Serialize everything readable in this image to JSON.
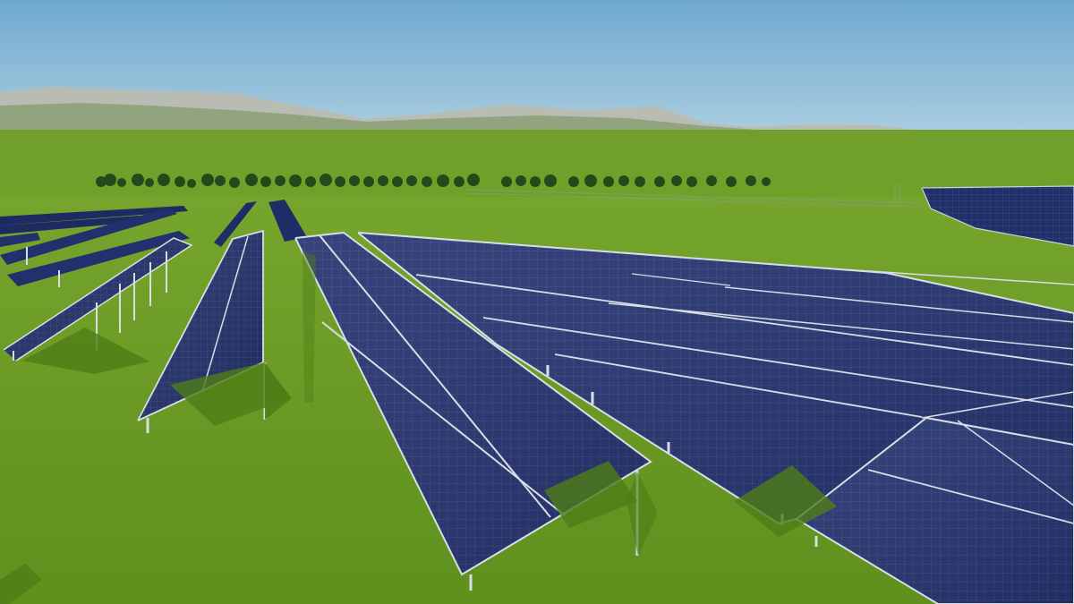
{
  "scene": {
    "palette": {
      "sky_top": "#7fb0cf",
      "sky_bottom": "#d9eaf0",
      "hills": "#b8bbb1",
      "grass_far": "#6e9f2a",
      "grass_near": "#5f8f1d",
      "panel": "#23316f",
      "panel_dark": "#18255c",
      "frame": "#d8dde8",
      "trees": "#244a1b",
      "shadow": "#4f7d17"
    },
    "elements": {
      "sky": "sky-gradient",
      "mountains": "distant-hills",
      "trees": "tree-line",
      "solar_farm": "solar-panel-array",
      "ground": "green-field"
    }
  }
}
